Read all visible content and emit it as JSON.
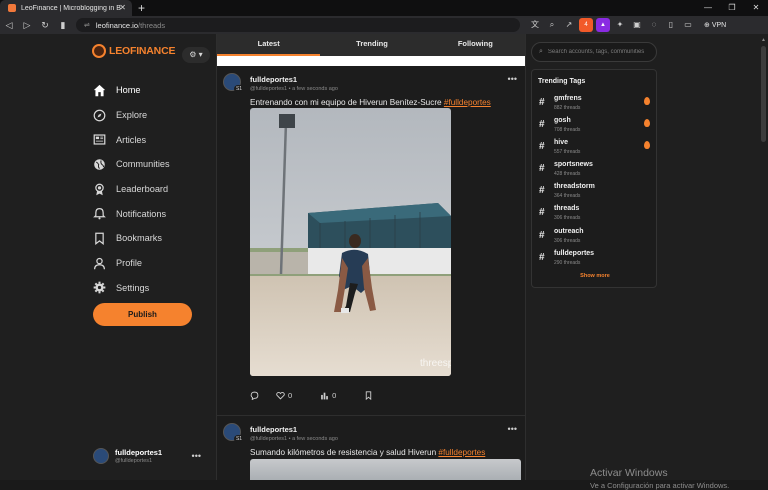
{
  "browser": {
    "tab_title": "LeoFinance | Microblogging in B",
    "url_host": "leofinance.io",
    "url_path": "/threads",
    "shield_badge": "4",
    "vpn_label": "VPN"
  },
  "sidebar": {
    "logo_text": "LEOFINANCE",
    "nav": [
      {
        "label": "Home",
        "icon": "home-icon"
      },
      {
        "label": "Explore",
        "icon": "compass-icon"
      },
      {
        "label": "Articles",
        "icon": "newspaper-icon"
      },
      {
        "label": "Communities",
        "icon": "globe-icon"
      },
      {
        "label": "Leaderboard",
        "icon": "award-icon"
      },
      {
        "label": "Notifications",
        "icon": "bell-icon"
      },
      {
        "label": "Bookmarks",
        "icon": "bookmark-icon"
      },
      {
        "label": "Profile",
        "icon": "user-icon"
      },
      {
        "label": "Settings",
        "icon": "gear-icon"
      }
    ],
    "publish_label": "Publish",
    "account": {
      "name": "fulldeportes1",
      "handle": "@fulldeportes1"
    }
  },
  "feed": {
    "tabs": [
      "Latest",
      "Trending",
      "Following"
    ],
    "posts": [
      {
        "author": "fulldeportes1",
        "handle": "@fulldeportes1",
        "time": "a few seconds ago",
        "avatar_badge": "S1",
        "text": "Entrenando con mi equipo de Hiverun Benítez-Sucre ",
        "hashtag": "#fulldeportes",
        "likes": "0",
        "views": "0",
        "media_watermark": "threespeak"
      },
      {
        "author": "fulldeportes1",
        "handle": "@fulldeportes1",
        "time": "a few seconds ago",
        "avatar_badge": "S1",
        "text": "Sumando kilómetros de resistencia y salud Hiverun ",
        "hashtag": "#fulldeportes"
      }
    ]
  },
  "right": {
    "search_placeholder": "Search accounts, tags, communities",
    "trending_title": "Trending Tags",
    "tags": [
      {
        "name": "gmfrens",
        "count": "882 threads",
        "hot": true
      },
      {
        "name": "gosh",
        "count": "708 threads",
        "hot": true
      },
      {
        "name": "hive",
        "count": "557 threads",
        "hot": true
      },
      {
        "name": "sportsnews",
        "count": "428 threads",
        "hot": false
      },
      {
        "name": "threadstorm",
        "count": "364 threads",
        "hot": false
      },
      {
        "name": "threads",
        "count": "306 threads",
        "hot": false
      },
      {
        "name": "outreach",
        "count": "306 threads",
        "hot": false
      },
      {
        "name": "fulldeportes",
        "count": "290 threads",
        "hot": false
      }
    ],
    "show_more": "Show more"
  },
  "watermark": {
    "title": "Activar Windows",
    "subtitle": "Ve a Configuración para activar Windows."
  },
  "colors": {
    "accent": "#f5822e",
    "background": "#1f1f1f"
  }
}
